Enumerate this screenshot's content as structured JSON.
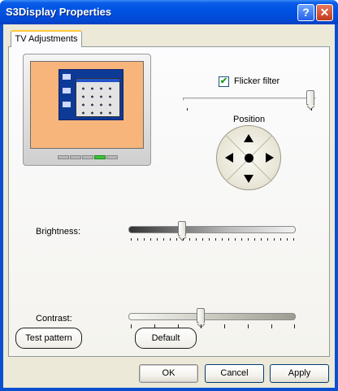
{
  "window": {
    "title": "S3Display Properties",
    "help_button": "?",
    "close_button": "✕"
  },
  "tabs": [
    {
      "label": "TV Adjustments",
      "active": true
    }
  ],
  "flicker_filter": {
    "label": "Flicker filter",
    "checked": true,
    "slider_position": 0.98
  },
  "position": {
    "label": "Position",
    "icons": [
      "arrow-up-icon",
      "arrow-down-icon",
      "arrow-left-icon",
      "arrow-right-icon",
      "center-dot-icon"
    ]
  },
  "brightness": {
    "label": "Brightness:",
    "value_fraction": 0.32
  },
  "contrast": {
    "label": "Contrast:",
    "value_fraction": 0.43
  },
  "buttons": {
    "test_pattern": "Test pattern",
    "default": "Default",
    "ok": "OK",
    "cancel": "Cancel",
    "apply": "Apply"
  },
  "colors": {
    "titlebar": "#0054e3",
    "dialog_background": "#ece9d8",
    "tab_highlight": "#ffc83c",
    "monitor_screen": "#f7b57b",
    "monitor_led": "#3ec23e"
  }
}
